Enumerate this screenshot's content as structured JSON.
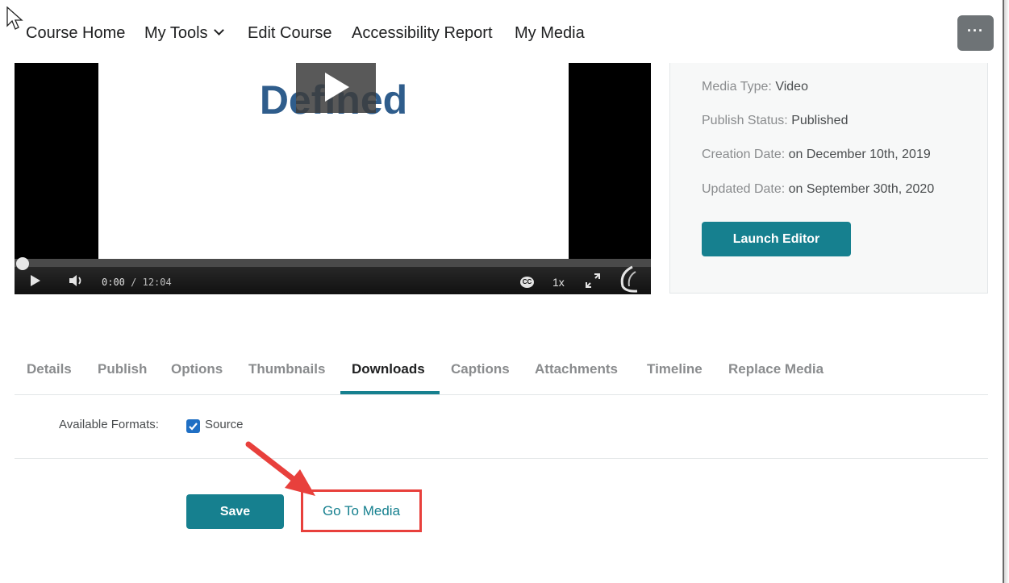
{
  "nav": {
    "items": [
      "Course Home",
      "My Tools",
      "Edit Course",
      "Accessibility Report",
      "My Media"
    ],
    "more_label": "···"
  },
  "video": {
    "title_text": "Defined",
    "current_time": "0:00",
    "duration": "/ 12:04",
    "cc_label": "CC",
    "speed": "1x"
  },
  "info": {
    "media_type_label": "Media Type:",
    "media_type_value": "Video",
    "publish_status_label": "Publish Status:",
    "publish_status_value": "Published",
    "creation_date_label": "Creation Date:",
    "creation_date_value": "on December 10th, 2019",
    "updated_date_label": "Updated Date:",
    "updated_date_value": "on September 30th, 2020",
    "launch_editor": "Launch Editor"
  },
  "tabs": [
    {
      "label": "Details",
      "active": false
    },
    {
      "label": "Publish",
      "active": false
    },
    {
      "label": "Options",
      "active": false
    },
    {
      "label": "Thumbnails",
      "active": false
    },
    {
      "label": "Downloads",
      "active": true
    },
    {
      "label": "Captions",
      "active": false
    },
    {
      "label": "Attachments",
      "active": false
    },
    {
      "label": "Timeline",
      "active": false
    },
    {
      "label": "Replace Media",
      "active": false
    }
  ],
  "downloads": {
    "formats_label": "Available Formats:",
    "source_label": "Source",
    "source_checked": true
  },
  "actions": {
    "save_label": "Save",
    "go_to_media_label": "Go To Media"
  },
  "colors": {
    "accent": "#16808f",
    "highlight": "#e8403c"
  }
}
